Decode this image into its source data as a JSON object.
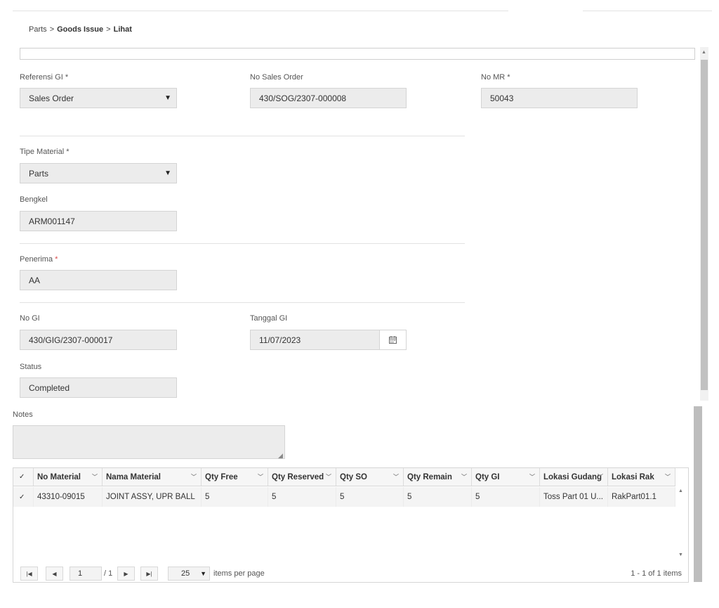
{
  "breadcrumb": {
    "root": "Parts",
    "sep": ">",
    "section": "Goods Issue",
    "page": "Lihat"
  },
  "form": {
    "referensi_gi": {
      "label": "Referensi GI",
      "value": "Sales Order"
    },
    "no_sales_order": {
      "label": "No Sales Order",
      "value": "430/SOG/2307-000008"
    },
    "no_mr": {
      "label": "No MR",
      "value": "50043"
    },
    "tipe_material": {
      "label": "Tipe Material",
      "value": "Parts"
    },
    "bengkel": {
      "label": "Bengkel",
      "value": "ARM001147"
    },
    "penerima": {
      "label": "Penerima",
      "value": "AA"
    },
    "no_gi": {
      "label": "No GI",
      "value": "430/GIG/2307-000017"
    },
    "tanggal_gi": {
      "label": "Tanggal GI",
      "value": "11/07/2023"
    },
    "status": {
      "label": "Status",
      "value": "Completed"
    },
    "notes": {
      "label": "Notes",
      "value": ""
    },
    "required_mark": "*"
  },
  "grid": {
    "columns": [
      "No Material",
      "Nama Material",
      "Qty Free",
      "Qty Reserved",
      "Qty SO",
      "Qty Remain",
      "Qty GI",
      "Lokasi Gudang",
      "Lokasi Rak"
    ],
    "rows": [
      [
        "43310-09015",
        "JOINT ASSY, UPR BALL",
        "5",
        "5",
        "5",
        "5",
        "5",
        "Toss Part 01 U...",
        "RakPart01.1"
      ]
    ]
  },
  "pager": {
    "page": "1",
    "of_pages": "/ 1",
    "page_size": "25",
    "per_page_label": "items per page",
    "summary": "1 - 1 of 1 items"
  },
  "icons": {
    "chevron": "chevron-down-icon",
    "calendar": "calendar-icon",
    "first": "first-page-icon",
    "prev": "prev-page-icon",
    "next": "next-page-icon",
    "last": "last-page-icon"
  }
}
